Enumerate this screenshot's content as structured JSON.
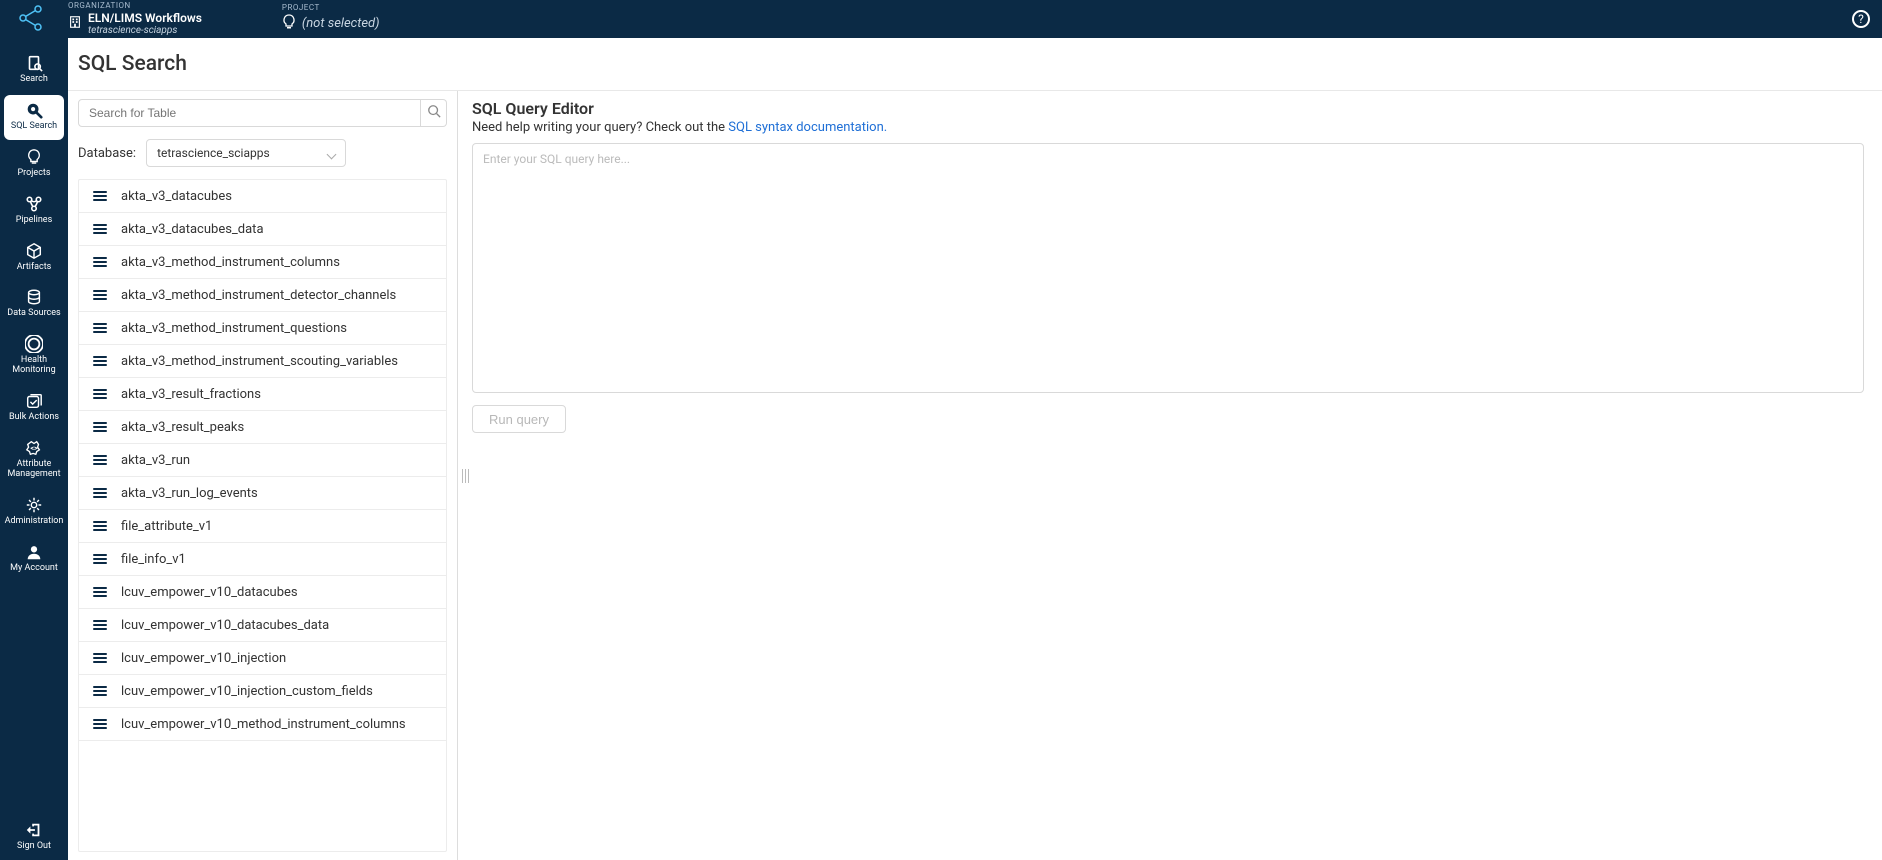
{
  "header": {
    "organization_label": "ORGANIZATION",
    "organization_name": "ELN/LIMS Workflows",
    "organization_sub": "tetrascience-sciapps",
    "project_label": "PROJECT",
    "project_value": "(not selected)",
    "help_char": "?"
  },
  "nav": {
    "items": [
      {
        "id": "search",
        "label": "Search"
      },
      {
        "id": "sql-search",
        "label": "SQL Search"
      },
      {
        "id": "projects",
        "label": "Projects"
      },
      {
        "id": "pipelines",
        "label": "Pipelines"
      },
      {
        "id": "artifacts",
        "label": "Artifacts"
      },
      {
        "id": "data-sources",
        "label": "Data Sources"
      },
      {
        "id": "health-monitoring",
        "label": "Health Monitoring"
      },
      {
        "id": "bulk-actions",
        "label": "Bulk Actions"
      },
      {
        "id": "attribute-management",
        "label": "Attribute Management"
      },
      {
        "id": "administration",
        "label": "Administration"
      },
      {
        "id": "my-account",
        "label": "My Account"
      }
    ],
    "signout": "Sign Out",
    "active_id": "sql-search"
  },
  "page": {
    "title": "SQL Search"
  },
  "left": {
    "search_placeholder": "Search for Table",
    "db_label": "Database:",
    "db_selected": "tetrascience_sciapps",
    "tables": [
      "akta_v3_datacubes",
      "akta_v3_datacubes_data",
      "akta_v3_method_instrument_columns",
      "akta_v3_method_instrument_detector_channels",
      "akta_v3_method_instrument_questions",
      "akta_v3_method_instrument_scouting_variables",
      "akta_v3_result_fractions",
      "akta_v3_result_peaks",
      "akta_v3_run",
      "akta_v3_run_log_events",
      "file_attribute_v1",
      "file_info_v1",
      "lcuv_empower_v10_datacubes",
      "lcuv_empower_v10_datacubes_data",
      "lcuv_empower_v10_injection",
      "lcuv_empower_v10_injection_custom_fields",
      "lcuv_empower_v10_method_instrument_columns"
    ]
  },
  "right": {
    "title": "SQL Query Editor",
    "help_prefix": "Need help writing your query? Check out the ",
    "help_link": "SQL syntax documentation.",
    "sql_placeholder": "Enter your SQL query here...",
    "run_label": "Run query"
  }
}
